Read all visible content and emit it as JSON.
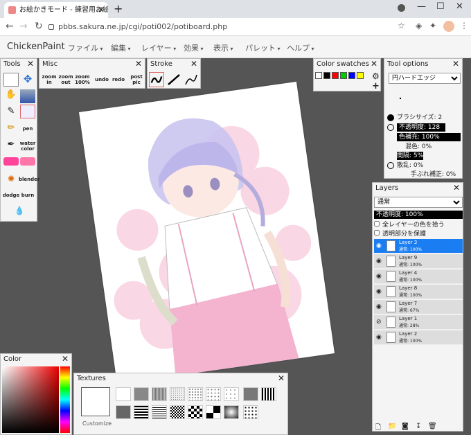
{
  "browser": {
    "tab_title": "お絵かきモード - 練習用お絵かき掲示",
    "new_tab": "+",
    "url": "pbbs.sakura.ne.jp/cgi/poti002/potiboard.php"
  },
  "app": {
    "brand": "ChickenPaint",
    "menu": [
      "ファイル",
      "編集",
      "レイヤー",
      "効果",
      "表示",
      "パレット",
      "ヘルプ"
    ]
  },
  "tools_panel": {
    "title": "Tools",
    "labels": {
      "pen": "pen",
      "watercolor": "water color",
      "blender": "blender",
      "dodge": "dodge",
      "burn": "burn"
    }
  },
  "misc_panel": {
    "title": "Misc",
    "buttons": [
      "zoom in",
      "zoom out",
      "zoom 100%",
      "undo",
      "redo",
      "post pic"
    ]
  },
  "stroke_panel": {
    "title": "Stroke"
  },
  "swatches_panel": {
    "title": "Color swatches",
    "colors": [
      "#ffffff",
      "#000000",
      "#ff0000",
      "#00cc00",
      "#0000ff",
      "#ffff00"
    ]
  },
  "tool_options": {
    "title": "Tool options",
    "brush_tip": "円ハードエッジ",
    "brush_size": "ブラシサイズ: 2",
    "opacity": "不透明度: 128",
    "color_fill": "色補充: 100%",
    "mix": "混色: 0%",
    "spacing": "間隔: 5%",
    "scatter": "散乱: 0%",
    "smoothing": "手ぶれ補正: 0%"
  },
  "layers_panel": {
    "title": "Layers",
    "blend_mode": "通常",
    "opacity": "不透明度: 100%",
    "sample_all": "全レイヤーの色を拾う",
    "lock_alpha": "透明部分を保護",
    "items": [
      {
        "name": "Layer 3",
        "meta": "通常: 100%",
        "visible": true,
        "active": true
      },
      {
        "name": "Layer 9",
        "meta": "通常: 100%",
        "visible": true,
        "active": false
      },
      {
        "name": "Layer 4",
        "meta": "通常: 100%",
        "visible": true,
        "active": false
      },
      {
        "name": "Layer 8",
        "meta": "通常: 100%",
        "visible": true,
        "active": false
      },
      {
        "name": "Layer 7",
        "meta": "通常: 67%",
        "visible": true,
        "active": false
      },
      {
        "name": "Layer 1",
        "meta": "通常: 28%",
        "visible": false,
        "active": false
      },
      {
        "name": "Layer 2",
        "meta": "通常: 100%",
        "visible": true,
        "active": false
      }
    ]
  },
  "color_panel": {
    "title": "Color"
  },
  "textures_panel": {
    "title": "Textures",
    "customize": "Customize"
  }
}
